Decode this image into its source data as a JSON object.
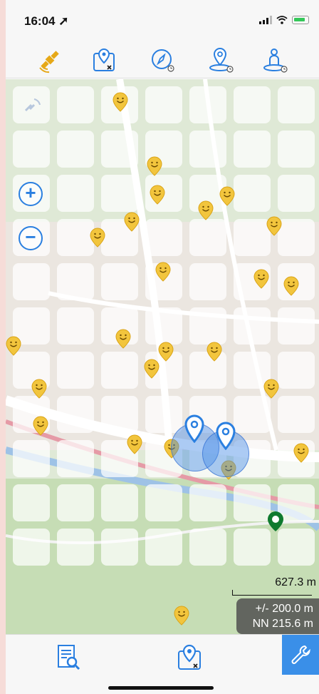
{
  "status_bar": {
    "time": "16:04 ➚"
  },
  "toolbar": {
    "buttons": [
      {
        "name": "gps-satellite-button",
        "icon": "satellite-icon"
      },
      {
        "name": "map-pin-remove-button",
        "icon": "map-pin-x-icon"
      },
      {
        "name": "compass-timer-button",
        "icon": "compass-clock-icon"
      },
      {
        "name": "location-timer-button",
        "icon": "location-pin-clock-icon"
      },
      {
        "name": "person-location-timer-button",
        "icon": "person-pin-clock-icon"
      }
    ]
  },
  "map": {
    "zoom_in_label": "+",
    "zoom_out_label": "−",
    "scale_text": "627.3 m",
    "accuracy_text": "+/- 200.0 m",
    "altitude_text": "NN 215.6 m"
  },
  "bottom_bar": {
    "buttons": [
      {
        "name": "search-list-button",
        "icon": "document-search-icon"
      },
      {
        "name": "map-pin-remove-button-bottom",
        "icon": "map-pin-x-icon"
      },
      {
        "name": "settings-button",
        "icon": "wrench-icon"
      }
    ]
  },
  "colors": {
    "accent": "#2a7fe0",
    "pin_yellow": "#f2c53d",
    "tile": "#ffffff"
  }
}
